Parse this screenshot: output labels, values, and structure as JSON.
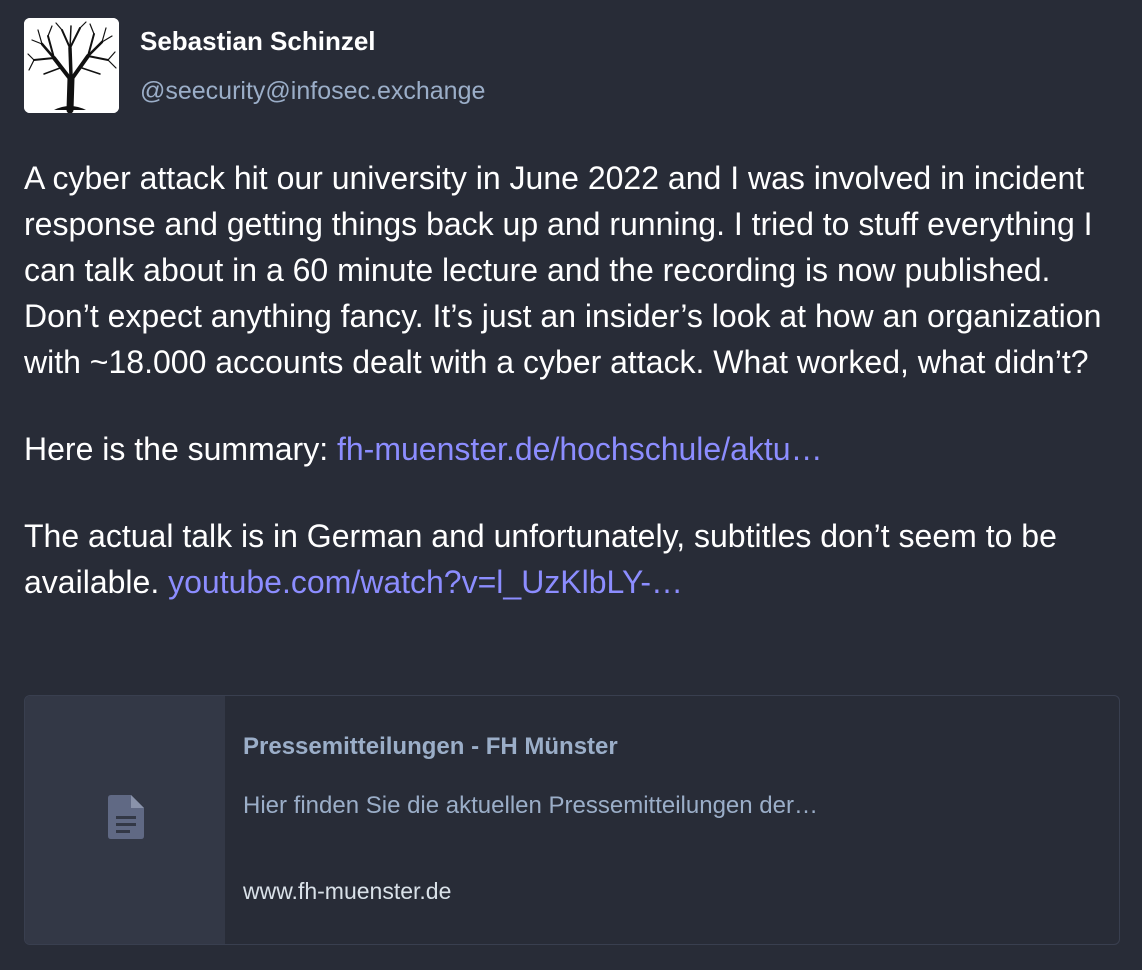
{
  "author": {
    "display_name": "Sebastian Schinzel",
    "handle": "@seecurity@infosec.exchange"
  },
  "status": {
    "paragraph1": "A cyber attack hit our university in June 2022 and I was involved in incident response and getting things back up and running. I tried to stuff everything I can talk about in a 60 minute lecture and the recording is now published. Don’t expect anything fancy. It’s just an insider’s look at how an organization with ~18.000 accounts dealt with a cyber attack. What worked, what didn’t?",
    "paragraph2_prefix": "Here is the summary: ",
    "summary_link": "fh-muenster.de/hochschule/aktu…",
    "paragraph3_prefix": "The actual talk is in German and unfortunately, subtitles don’t seem to be available. ",
    "video_link": "youtube.com/watch?v=l_UzKlbLY-…"
  },
  "card": {
    "title": "Pressemitteilungen - FH Münster",
    "description": "Hier finden Sie die aktuellen Pressemitteilungen der…",
    "host": "www.fh-muenster.de",
    "icon": "document-icon"
  },
  "colors": {
    "background": "#282c37",
    "link": "#8c8dff",
    "secondary_text": "#9baec8",
    "thumbnail": "#333846"
  }
}
